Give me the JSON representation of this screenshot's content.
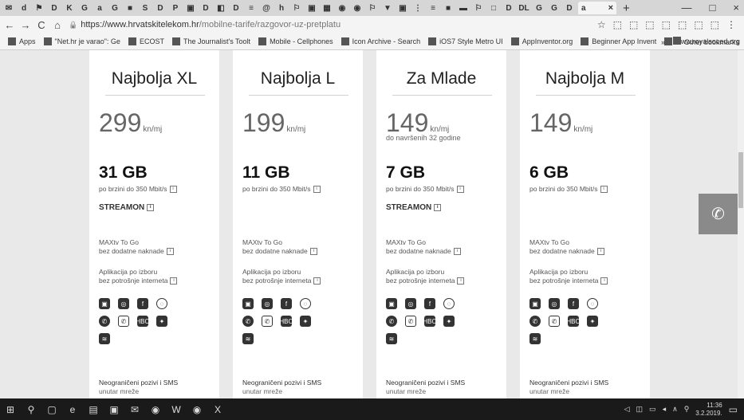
{
  "browser": {
    "tabs_left": [
      "✉",
      "d",
      "⚑",
      "D",
      "K",
      "G",
      "a",
      "G",
      "■",
      "S",
      "D",
      "P",
      "▣",
      "D",
      "◧",
      "D",
      "≡",
      "@",
      "h",
      "⚐",
      "▣",
      "▦",
      "◉",
      "◉",
      "⚐",
      "▼",
      "▣",
      "⋮",
      "≡",
      "■",
      "▬",
      "⚐",
      "□",
      "D",
      "DL",
      "G",
      "G",
      "D"
    ],
    "active_tab_icon": "a",
    "active_tab_close": "×",
    "new_tab": "+",
    "window_controls": [
      "—",
      "□",
      "×"
    ],
    "nav": {
      "back": "←",
      "forward": "→",
      "reload": "C",
      "home": "⌂"
    },
    "url_prefix": "https://www.hrvatskitelekom.hr",
    "url_path": "/mobilne-tarife/razgovor-uz-pretplatu",
    "extensions": [
      "☆",
      "⬚",
      "⬚",
      "⬚",
      "⬚",
      "⬚",
      "⬚",
      "⬚",
      "⋮"
    ]
  },
  "bookmarks": [
    {
      "label": "Apps"
    },
    {
      "label": "\"Net.hr je varao\": Ge"
    },
    {
      "label": "ECOST"
    },
    {
      "label": "The Journalist's Toolt"
    },
    {
      "label": "Mobile - Cellphones"
    },
    {
      "label": "Icon Archive - Search"
    },
    {
      "label": "iOS7 Style Metro UI"
    },
    {
      "label": "AppInventor.org"
    },
    {
      "label": "Beginner App Invent"
    },
    {
      "label": "www.royalsoced.org"
    }
  ],
  "bookmarks_more": "»",
  "bookmarks_other": "Other bookmarks",
  "plans": [
    {
      "name": "Najbolja XL",
      "price": "299",
      "unit": "kn/mj",
      "age_note": "",
      "data": "31 GB",
      "speed": "po brzini do 350 Mbit/s",
      "stream": "STREAMON",
      "maxtv_1": "MAXtv To Go",
      "maxtv_2": "bez dodatne naknade",
      "apl_1": "Aplikacija po izboru",
      "apl_2": "bez potrošnje interneta",
      "neg_1": "Neograničeni pozivi i SMS",
      "neg_2": "unutar mreže"
    },
    {
      "name": "Najbolja L",
      "price": "199",
      "unit": "kn/mj",
      "age_note": "",
      "data": "11 GB",
      "speed": "po brzini do 350 Mbit/s",
      "stream": "",
      "maxtv_1": "MAXtv To Go",
      "maxtv_2": "bez dodatne naknade",
      "apl_1": "Aplikacija po izboru",
      "apl_2": "bez potrošnje interneta",
      "neg_1": "Neograničeni pozivi i SMS",
      "neg_2": "unutar mreže"
    },
    {
      "name": "Za Mlade",
      "price": "149",
      "unit": "kn/mj",
      "age_note": "do navršenih 32 godine",
      "data": "7 GB",
      "speed": "po brzini do 350 Mbit/s",
      "stream": "STREAMON",
      "maxtv_1": "MAXtv To Go",
      "maxtv_2": "bez dodatne naknade",
      "apl_1": "Aplikacija po izboru",
      "apl_2": "bez potrošnje interneta",
      "neg_1": "Neograničeni pozivi i SMS",
      "neg_2": "unutar mreže"
    },
    {
      "name": "Najbolja M",
      "price": "149",
      "unit": "kn/mj",
      "age_note": "",
      "data": "6 GB",
      "speed": "po brzini do 350 Mbit/s",
      "stream": "",
      "maxtv_1": "MAXtv To Go",
      "maxtv_2": "bez dodatne naknade",
      "apl_1": "Aplikacija po izboru",
      "apl_2": "bez potrošnje interneta",
      "neg_1": "Neograničeni pozivi i SMS",
      "neg_2": "unutar mreže"
    }
  ],
  "info_glyph": "i",
  "app_icons": {
    "row1": [
      "deezer-icon",
      "instagram-icon",
      "facebook-icon",
      "messenger-icon"
    ],
    "row2": [
      "whatsapp-icon",
      "viber-icon",
      "hbo-go-icon",
      "snapchat-icon"
    ],
    "row3": [
      "tidal-icon"
    ],
    "glyphs": {
      "row1": [
        "▣",
        "◎",
        "f",
        "◌"
      ],
      "row2": [
        "✆",
        "✆",
        "HBO",
        "✦"
      ],
      "row3": [
        "≋"
      ]
    }
  },
  "phone_button_glyph": "✆",
  "taskbar": {
    "icons": [
      "⊞",
      "⚲",
      "▢",
      "e",
      "▤",
      "▣",
      "✉",
      "◉",
      "W",
      "◉",
      "X"
    ],
    "tray": [
      "⚲",
      "∧",
      "◂",
      "▭",
      "◫",
      "◁"
    ],
    "time": "11:36",
    "date": "3.2.2019.",
    "notif": "▭"
  }
}
